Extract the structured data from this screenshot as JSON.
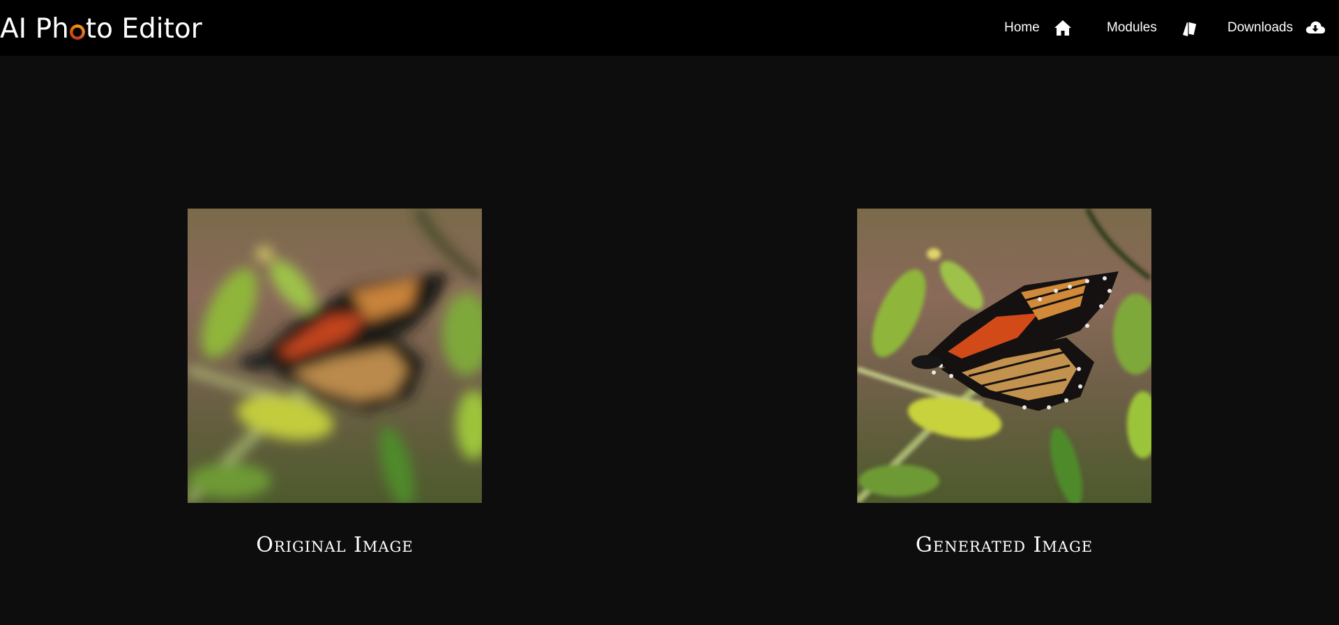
{
  "app": {
    "title_prefix": "AI Ph",
    "title_suffix": "to Editor",
    "logo_icon": "camera-aperture-ring"
  },
  "nav": {
    "items": [
      {
        "label": "Home",
        "icon": "home-icon"
      },
      {
        "label": "Modules",
        "icon": "cards-icon"
      },
      {
        "label": "Downloads",
        "icon": "cloud-download-icon"
      }
    ]
  },
  "panels": {
    "original": {
      "caption": "Original Image",
      "image": "blurred monarch butterfly on green leaves"
    },
    "generated": {
      "caption": "Generated Image",
      "image": "sharpened monarch butterfly on green leaves"
    }
  },
  "colors": {
    "navbar_bg": "#000000",
    "page_bg": "#0d0d0d",
    "text": "#ffffff",
    "accent": "#f39c12"
  }
}
